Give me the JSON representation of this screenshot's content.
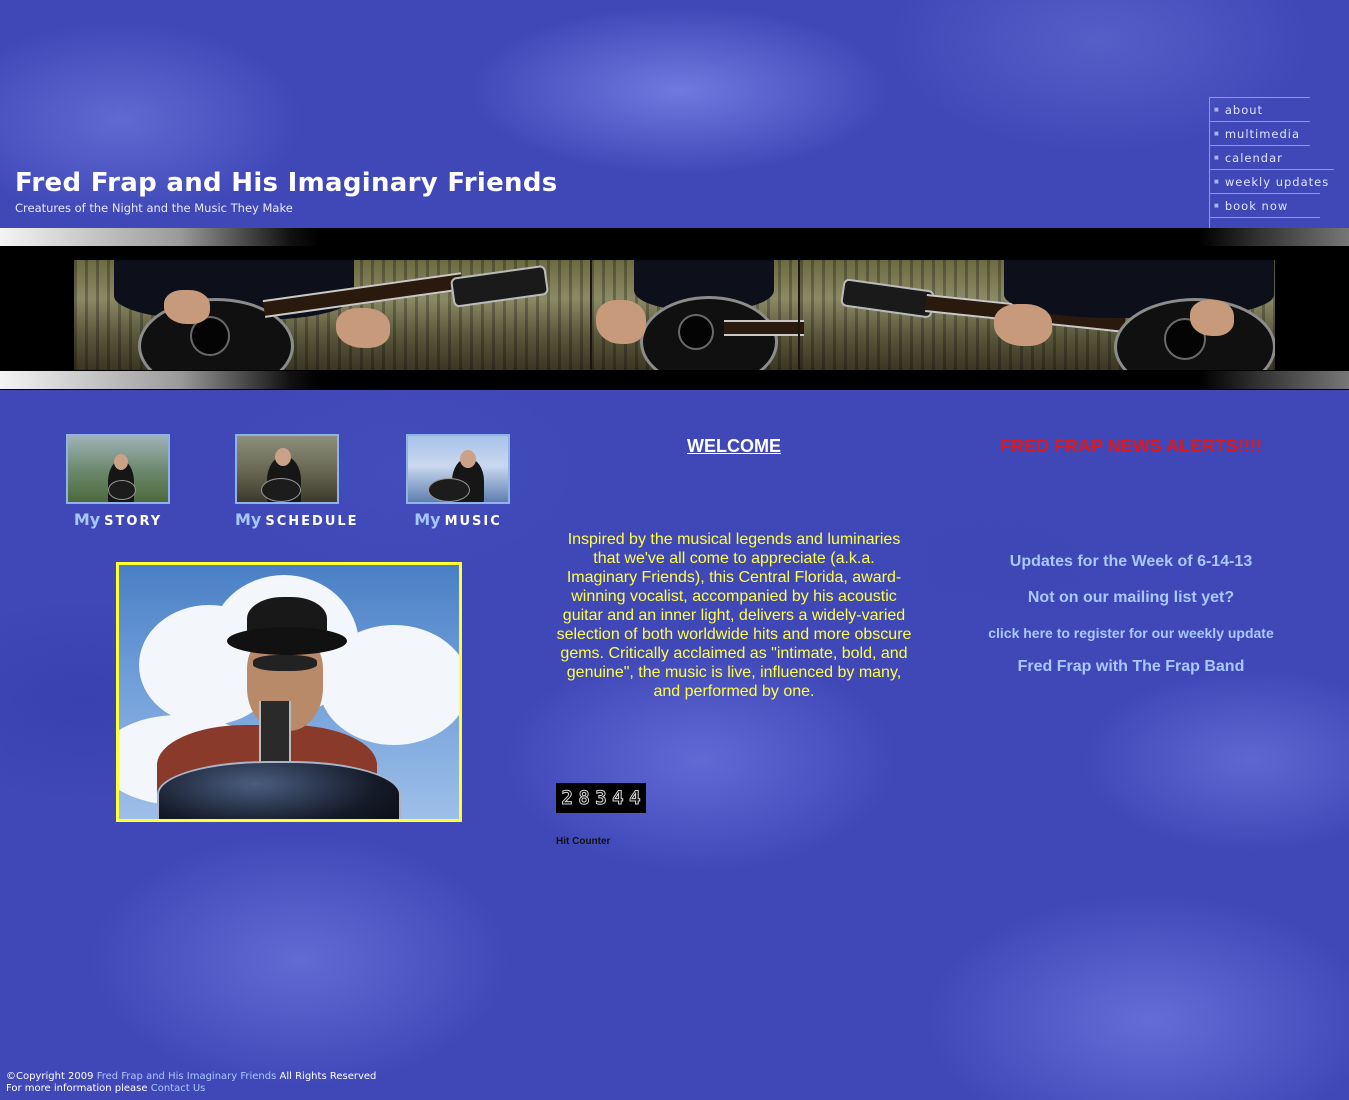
{
  "header": {
    "title": "Fred Frap and His Imaginary Friends",
    "subtitle": "Creatures of the Night and the Music They Make"
  },
  "nav": {
    "items": [
      {
        "label": "about"
      },
      {
        "label": "multimedia"
      },
      {
        "label": "calendar"
      },
      {
        "label": "weekly updates"
      },
      {
        "label": "book now"
      }
    ]
  },
  "sections": [
    {
      "my": "My",
      "word": "STORY"
    },
    {
      "my": "My",
      "word": "SCHEDULE"
    },
    {
      "my": "My",
      "word": "MUSIC"
    }
  ],
  "welcome": {
    "heading": "WELCOME",
    "body": "Inspired by the musical legends and luminaries that we've all come to appreciate (a.k.a. Imaginary Friends), this Central Florida, award-winning vocalist, accompanied by his acoustic guitar and an inner light, delivers a widely-varied selection of both worldwide hits and more obscure gems. Critically acclaimed as \"intimate, bold, and genuine\", the music is live, influenced by many, and performed by one."
  },
  "hit_counter": {
    "digits": [
      "2",
      "8",
      "3",
      "4",
      "4"
    ],
    "label": "Hit Counter"
  },
  "news": {
    "heading": "FRED FRAP NEWS ALERTS!!!!",
    "updates": "Updates for the Week of 6-14-13",
    "mailing": "Not on our mailing list yet?",
    "register": "click here to register for our weekly update",
    "band": "Fred Frap with The Frap Band"
  },
  "footer": {
    "copyright_prefix": "©Copyright 2009",
    "site_name": "Fred Frap and His Imaginary Friends",
    "rights": "All Rights Reserved",
    "more_info": "For more information please",
    "contact_link": "Contact Us"
  },
  "colors": {
    "background": "#4048b8",
    "welcome_text": "#ffff44",
    "news_heading": "#e01818",
    "news_text": "#a9c8ff",
    "photo_border": "#ffff33"
  },
  "icons": {
    "nav_bullet": "bullet-icon"
  }
}
